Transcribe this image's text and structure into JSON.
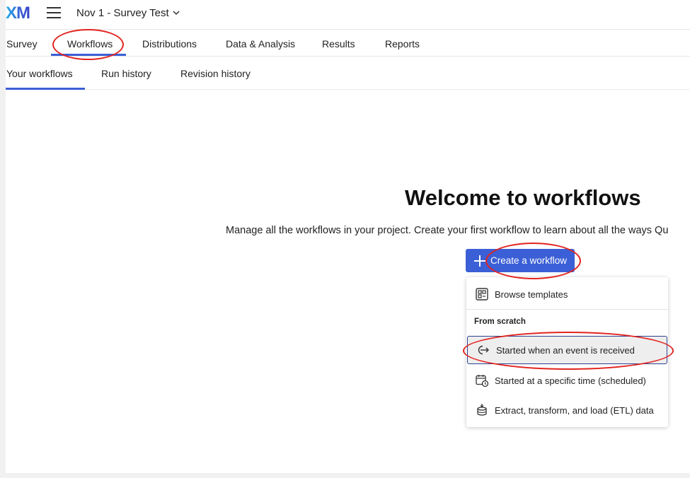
{
  "header": {
    "logo_text": "XM",
    "project_title": "Nov 1 - Survey Test"
  },
  "tabs": [
    {
      "label": "Survey"
    },
    {
      "label": "Workflows"
    },
    {
      "label": "Distributions"
    },
    {
      "label": "Data & Analysis"
    },
    {
      "label": "Results"
    },
    {
      "label": "Reports"
    }
  ],
  "subtabs": [
    {
      "label": "Your workflows"
    },
    {
      "label": "Run history"
    },
    {
      "label": "Revision history"
    }
  ],
  "welcome": {
    "title": "Welcome to workflows",
    "description": "Manage all the workflows in your project. Create your first workflow to learn about all the ways Qu"
  },
  "create_button": {
    "label": "Create a workflow"
  },
  "dropdown": {
    "browse_label": "Browse templates",
    "section_label": "From scratch",
    "items": [
      {
        "label": "Started when an event is received",
        "icon": "event-arrow-icon"
      },
      {
        "label": "Started at a specific time (scheduled)",
        "icon": "calendar-clock-icon"
      },
      {
        "label": "Extract, transform, and load (ETL) data",
        "icon": "database-icon"
      }
    ]
  },
  "colors": {
    "accent": "#3b5fd6",
    "annotation": "#e2241f",
    "highlight_border": "#2b3f8f"
  }
}
